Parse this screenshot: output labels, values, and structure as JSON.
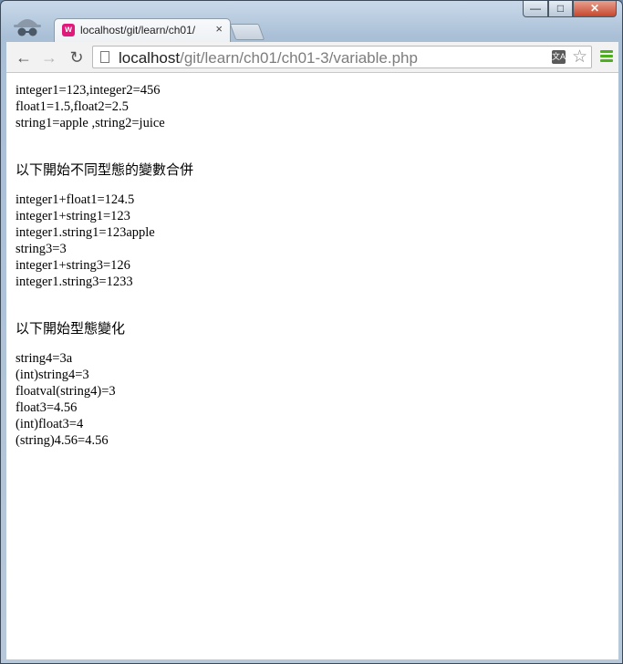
{
  "browser": {
    "tab": {
      "title": "localhost/git/learn/ch01/",
      "close": "×",
      "favicon": "w"
    },
    "window_buttons": {
      "minimize": "—",
      "maximize": "□",
      "close": "✕"
    },
    "nav": {
      "back": "←",
      "forward": "→",
      "reload": "↻"
    },
    "url": {
      "host": "localhost",
      "path": "/git/learn/ch01/ch01-3/variable.php"
    },
    "translate_glyph": "文A",
    "star_glyph": "☆"
  },
  "page": {
    "block1": [
      "integer1=123,integer2=456",
      "float1=1.5,float2=2.5",
      "string1=apple ,string2=juice"
    ],
    "heading1": "以下開始不同型態的變數合併",
    "block2": [
      "integer1+float1=124.5",
      "integer1+string1=123",
      "integer1.string1=123apple",
      "string3=3",
      "integer1+string3=126",
      "integer1.string3=1233"
    ],
    "heading2": "以下開始型態變化",
    "block3": [
      "string4=3a",
      "(int)string4=3",
      "floatval(string4)=3",
      "float3=4.56",
      "(int)float3=4",
      "(string)4.56=4.56"
    ]
  }
}
